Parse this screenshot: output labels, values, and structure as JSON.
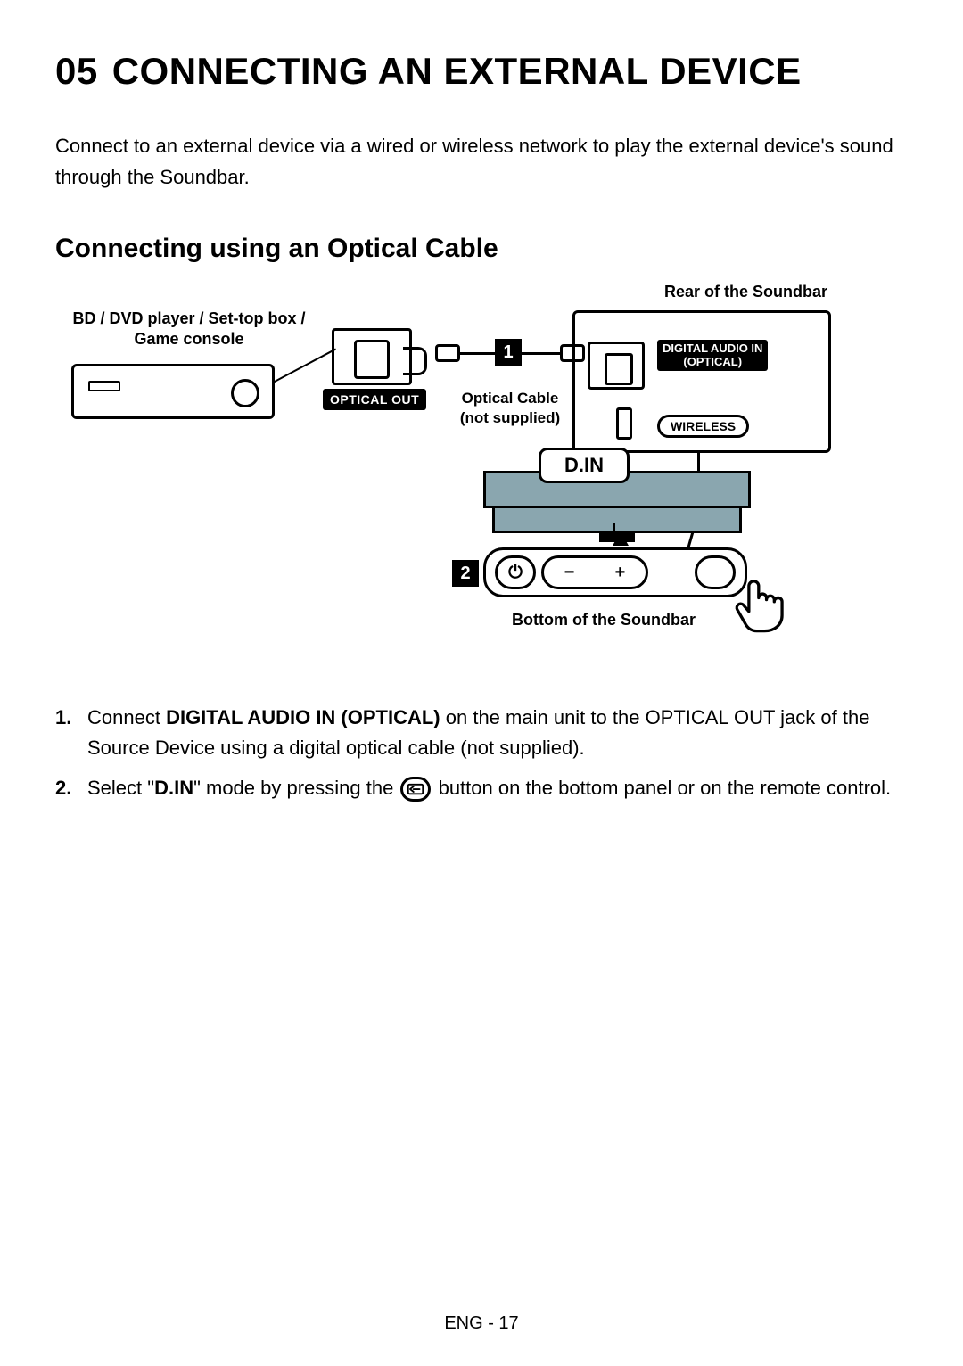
{
  "chapter": {
    "number": "05",
    "title": "CONNECTING AN EXTERNAL DEVICE"
  },
  "intro": "Connect to an external device via a wired or wireless network to play the external device's sound through the Soundbar.",
  "section_title": "Connecting using an Optical Cable",
  "diagram": {
    "rear_label": "Rear of the Soundbar",
    "source_label_line1": "BD / DVD player / Set-top box /",
    "source_label_line2": "Game console",
    "optical_out_tag": "OPTICAL OUT",
    "cable_label_line1": "Optical Cable",
    "cable_label_line2": "(not supplied)",
    "digital_audio_in_line1": "DIGITAL AUDIO IN",
    "digital_audio_in_line2": "(OPTICAL)",
    "wireless_pill": "WIRELESS",
    "din_badge": "D.IN",
    "bottom_label": "Bottom of the Soundbar",
    "callouts": {
      "one": "1",
      "two": "2"
    },
    "buttons": {
      "power": "⏻",
      "minus": "−",
      "plus": "+",
      "source_icon_name": "source-icon"
    }
  },
  "steps": [
    {
      "num": "1.",
      "parts": [
        {
          "t": "text",
          "v": "Connect "
        },
        {
          "t": "bold",
          "v": "DIGITAL AUDIO IN (OPTICAL)"
        },
        {
          "t": "text",
          "v": " on the main unit to the OPTICAL OUT jack of the Source Device using a digital optical cable (not supplied)."
        }
      ]
    },
    {
      "num": "2.",
      "parts": [
        {
          "t": "text",
          "v": "Select \""
        },
        {
          "t": "bold",
          "v": "D.IN"
        },
        {
          "t": "text",
          "v": "\" mode by pressing the "
        },
        {
          "t": "icon",
          "v": "source-button"
        },
        {
          "t": "text",
          "v": " button on the bottom panel or on the remote control."
        }
      ]
    }
  ],
  "footer": "ENG - 17"
}
